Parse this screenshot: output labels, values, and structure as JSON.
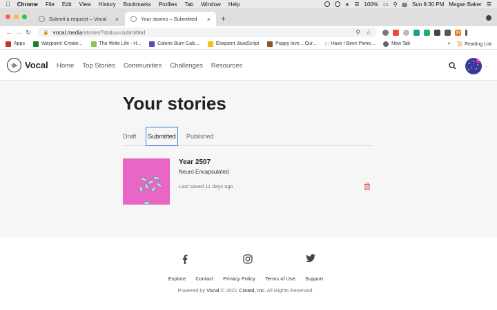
{
  "menubar": {
    "app": "Chrome",
    "items": [
      "File",
      "Edit",
      "View",
      "History",
      "Bookmarks",
      "Profiles",
      "Tab",
      "Window",
      "Help"
    ],
    "battery": "100%",
    "clock": "Sun 9:30 PM",
    "user": "Megan Baker"
  },
  "tabs": [
    {
      "title": "Submit a request – Vocal"
    },
    {
      "title": "Your stories – Submitted"
    }
  ],
  "address": {
    "host": "vocal.media",
    "path": "/stories?status=submitted"
  },
  "profile_initial": "M",
  "bookmarks": {
    "items": [
      {
        "label": "Apps",
        "color": "#c0392b"
      },
      {
        "label": "Waypoint: Create...",
        "color": "#1e7d32"
      },
      {
        "label": "The Write Life - H...",
        "color": "#8bc34a"
      },
      {
        "label": "Calorie Burn Calc...",
        "color": "#5b4cb8"
      },
      {
        "label": "Eloquent JavaScript",
        "color": "#f1c40f"
      },
      {
        "label": "Puppy love... Our...",
        "color": "#8d5524"
      },
      {
        "label": ";-- Have I Been Pwne...",
        "color": "#555555"
      },
      {
        "label": "New Tab",
        "color": "#666666"
      }
    ],
    "more": "»",
    "reading_list": "Reading List"
  },
  "site": {
    "logo": "Vocal",
    "nav": [
      "Home",
      "Top Stories",
      "Communities",
      "Challenges",
      "Resources"
    ],
    "avatar_badge": "V+"
  },
  "page": {
    "title": "Your stories",
    "tabs": [
      "Draft",
      "Submitted",
      "Published"
    ],
    "active_tab": "Submitted",
    "story": {
      "title": "Year 2507",
      "community": "Neuro Encapsulated",
      "saved": "Last saved 11 days ago"
    }
  },
  "footer": {
    "links": [
      "Explore",
      "Contact",
      "Privacy Policy",
      "Terms of Use",
      "Support"
    ],
    "powered_prefix": "Powered by",
    "powered_brand": "Vocal",
    "powered_suffix": "© 2021",
    "company": "Creatd, Inc.",
    "rights": "All Rights Reserved."
  },
  "colors": {
    "accent": "#3b78d8",
    "story_image": "#e965c6",
    "trash": "#d9534f"
  }
}
